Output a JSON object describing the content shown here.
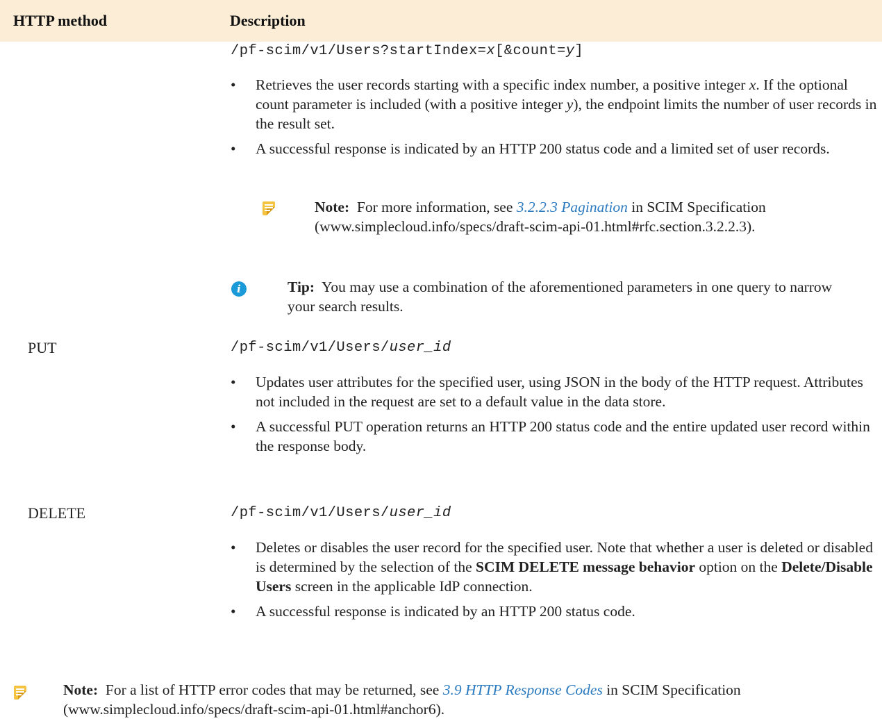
{
  "table": {
    "headers": {
      "method": "HTTP method",
      "description": "Description"
    },
    "row1": {
      "endpoint_prefix": "/pf-scim/v1/Users?startIndex=",
      "endpoint_x": "x",
      "endpoint_mid": "[&count=",
      "endpoint_y": "y",
      "endpoint_suffix": "]",
      "bullet1_a": "Retrieves the user records starting with a specific index number, a positive integer",
      "bullet1_x": "x",
      "bullet1_b": ". If the optional count parameter is included (with a positive integer",
      "bullet1_y": "y",
      "bullet1_c": "), the endpoint limits the number of user records in the result set.",
      "bullet2": "A successful response is indicated by an HTTP 200 status code and a limited set of user records.",
      "note_label": "Note:",
      "note_pre": "For more information, see",
      "note_link": "3.2.2.3 Pagination",
      "note_post": "in SCIM Specification (www.simplecloud.info/specs/draft-scim-api-01.html#rfc.section.3.2.2.3).",
      "tip_label": "Tip:",
      "tip_text": "You may use a combination of the aforementioned parameters in one query to narrow your search results."
    },
    "row2": {
      "method": "PUT",
      "endpoint_prefix": "/pf-scim/v1/Users/",
      "endpoint_var": "user_id",
      "bullet1": "Updates user attributes for the specified user, using JSON in the body of the HTTP request. Attributes not included in the request are set to a default value in the data store.",
      "bullet2": "A successful PUT operation returns an HTTP 200 status code and the entire updated user record within the response body."
    },
    "row3": {
      "method": "DELETE",
      "endpoint_prefix": "/pf-scim/v1/Users/",
      "endpoint_var": "user_id",
      "bullet1_a": "Deletes or disables the user record for the specified user. Note that whether a user is deleted or disabled is determined by the selection of the",
      "bullet1_b1": "SCIM DELETE message behavior",
      "bullet1_c": "option on the",
      "bullet1_b2": "Delete/Disable Users",
      "bullet1_d": "screen in the applicable IdP connection.",
      "bullet2": "A successful response is indicated by an HTTP 200 status code."
    }
  },
  "footer_note": {
    "label": "Note:",
    "pre": "For a list of HTTP error codes that may be returned, see",
    "link": "3.9 HTTP Response Codes",
    "post": "in SCIM Specification (www.simplecloud.info/specs/draft-scim-api-01.html#anchor6)."
  },
  "icons": {
    "note": "note-icon",
    "tip": "info-icon"
  },
  "colors": {
    "header_bg": "#fbedd6",
    "link": "#2a7ac0",
    "note_icon": "#f4c340",
    "tip_icon": "#1a9ad8"
  }
}
